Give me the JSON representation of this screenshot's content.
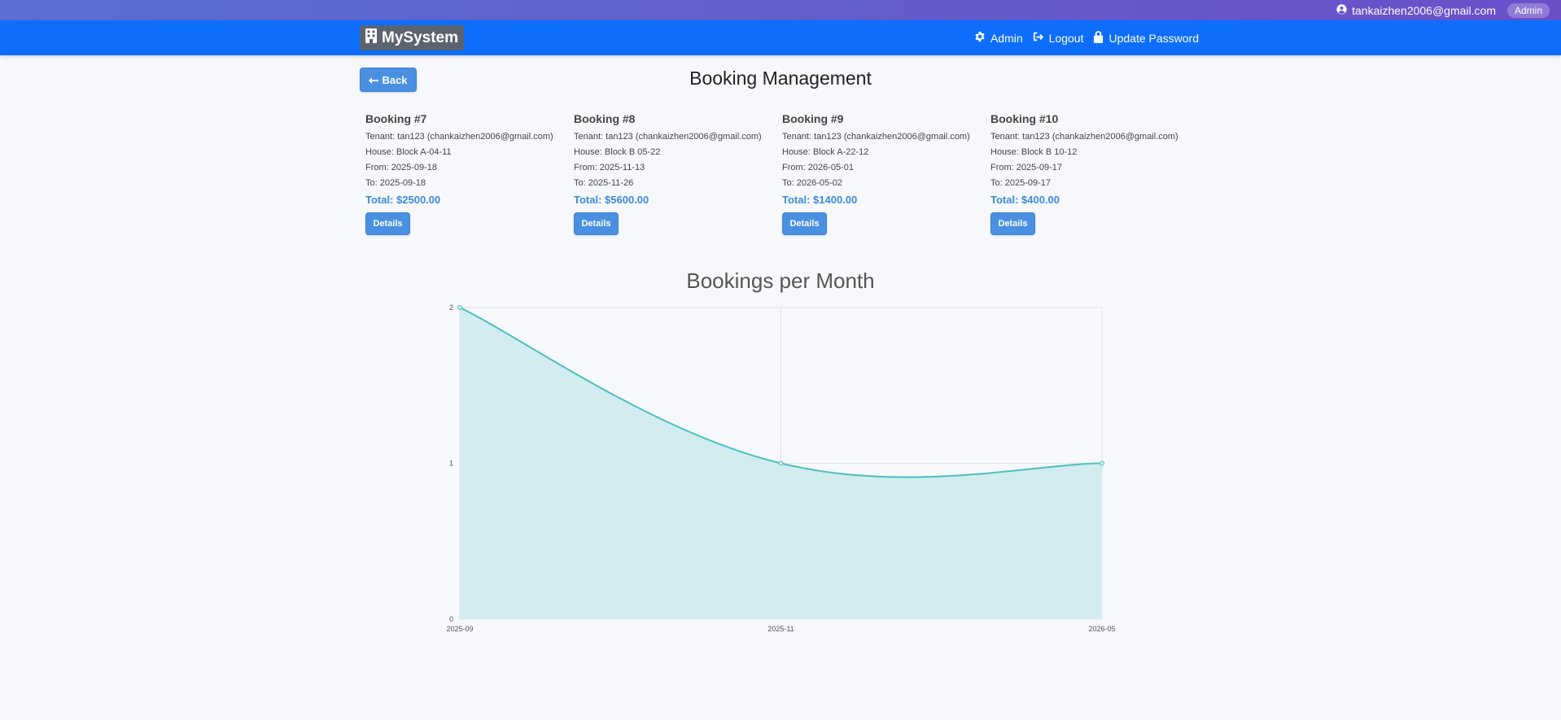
{
  "userbar": {
    "email": "tankaizhen2006@gmail.com",
    "role": "Admin"
  },
  "navbar": {
    "brand": "MySystem",
    "links": [
      {
        "label": "Admin",
        "icon": "gear-icon"
      },
      {
        "label": "Logout",
        "icon": "logout-icon"
      },
      {
        "label": "Update Password",
        "icon": "lock-icon"
      }
    ]
  },
  "page": {
    "back_label": "Back",
    "title": "Booking Management"
  },
  "bookings": [
    {
      "title": "Booking #7",
      "tenant": "Tenant: tan123 (chankaizhen2006@gmail.com)",
      "house": "House: Block A-04-11",
      "from": "From: 2025-09-18",
      "to": "To: 2025-09-18",
      "total": "Total: $2500.00",
      "details_label": "Details"
    },
    {
      "title": "Booking #8",
      "tenant": "Tenant: tan123 (chankaizhen2006@gmail.com)",
      "house": "House: Block B 05-22",
      "from": "From: 2025-11-13",
      "to": "To: 2025-11-26",
      "total": "Total: $5600.00",
      "details_label": "Details"
    },
    {
      "title": "Booking #9",
      "tenant": "Tenant: tan123 (chankaizhen2006@gmail.com)",
      "house": "House: Block A-22-12",
      "from": "From: 2026-05-01",
      "to": "To: 2026-05-02",
      "total": "Total: $1400.00",
      "details_label": "Details"
    },
    {
      "title": "Booking #10",
      "tenant": "Tenant: tan123 (chankaizhen2006@gmail.com)",
      "house": "House: Block B 10-12",
      "from": "From: 2025-09-17",
      "to": "To: 2025-09-17",
      "total": "Total: $400.00",
      "details_label": "Details"
    }
  ],
  "colors": {
    "navbar": "#0d6efd",
    "accent": "#4a90e2",
    "line": "#4bc0c0",
    "fill": "#d3ecef"
  },
  "chart_data": {
    "type": "area",
    "title": "Bookings per Month",
    "categories": [
      "2025-09",
      "2025-11",
      "2026-05"
    ],
    "values": [
      2,
      1,
      1
    ],
    "ylim": [
      0,
      2
    ],
    "yticks": [
      "2",
      "1",
      "0"
    ],
    "grid": true,
    "legend": "none"
  }
}
